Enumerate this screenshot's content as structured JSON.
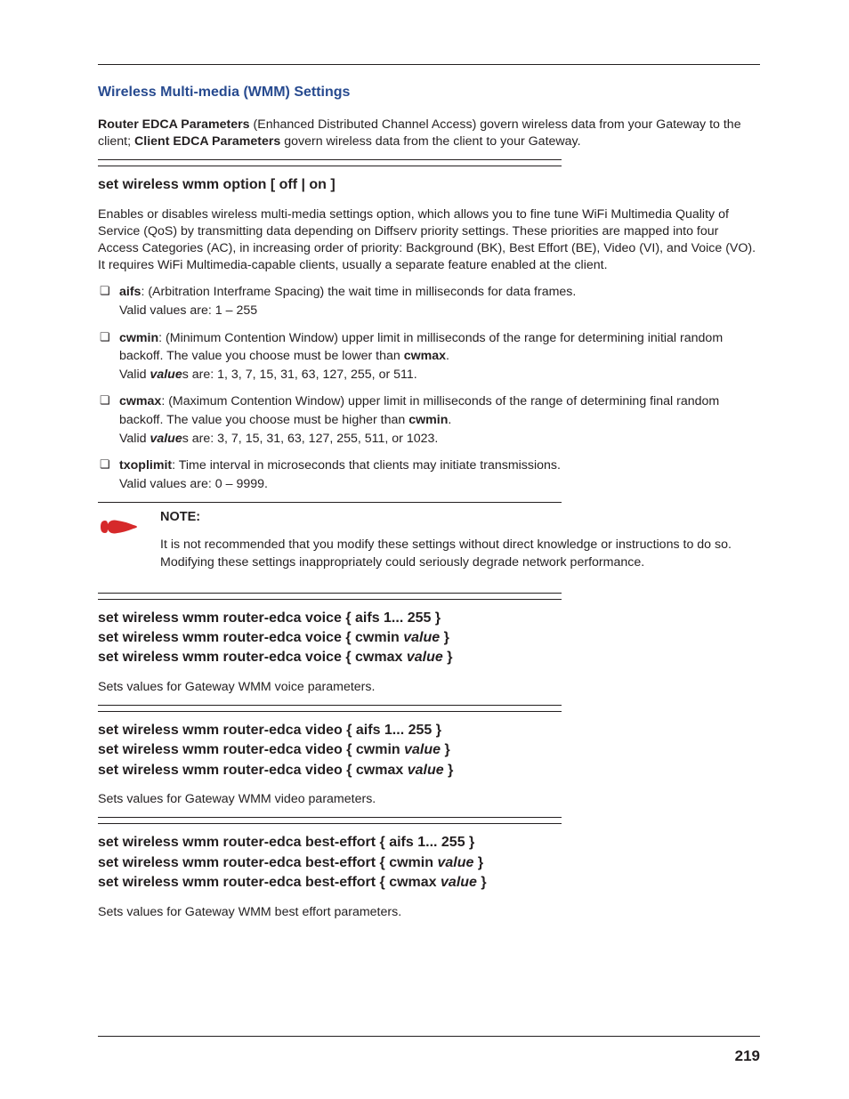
{
  "section_title": "Wireless Multi-media (WMM) Settings",
  "intro": {
    "b1": "Router EDCA Parameters",
    "t1": " (Enhanced Distributed Channel Access) govern wireless data from your Gateway to the client; ",
    "b2": "Client EDCA Parameters",
    "t2": " govern wireless data from the client to your Gateway."
  },
  "cmd1": {
    "title": "set wireless wmm option [ off | on ]",
    "desc": "Enables or disables wireless multi-media settings option, which allows you to fine tune WiFi Multimedia Quality of Service (QoS) by transmitting data depending on Diffserv priority settings. These priorities are mapped into four Access Categories (AC), in increasing order of priority: Background (BK), Best Effort (BE), Video (VI), and Voice (VO). It requires WiFi Multimedia-capable clients, usually a separate feature enabled at the client."
  },
  "bullets": {
    "aifs": {
      "label": "aifs",
      "desc": ": (Arbitration Interframe Spacing) the wait time in milliseconds for data frames.",
      "valid": "Valid values are: 1 – 255"
    },
    "cwmin": {
      "label": "cwmin",
      "desc1": ": (Minimum Contention Window) upper limit in milliseconds of the range for determining initial random backoff. The value you choose must be lower than ",
      "ref": "cwmax",
      "valid_pre": "Valid ",
      "valid_em": "value",
      "valid_post": "s are: 1, 3, 7, 15, 31, 63, 127, 255, or 511."
    },
    "cwmax": {
      "label": "cwmax",
      "desc1": ": (Maximum Contention Window) upper limit in milliseconds of the range of determining final random backoff. The value you choose must be higher than ",
      "ref": "cwmin",
      "valid_pre": "Valid ",
      "valid_em": "value",
      "valid_post": "s are: 3, 7, 15, 31, 63, 127, 255, 511, or 1023."
    },
    "txop": {
      "label": "txoplimit",
      "desc": ": Time interval in microseconds that clients may initiate transmissions.",
      "valid": "Valid values are: 0 – 9999."
    }
  },
  "note": {
    "heading": "NOTE:",
    "body": "It is not recommended that you modify these settings without direct knowledge or instructions to do so. Modifying these settings inappropriately could seriously degrade network performance."
  },
  "groups": [
    {
      "lines": [
        {
          "pre": "set wireless wmm router-edca voice { aifs 1... 255 }"
        },
        {
          "pre": "set wireless wmm router-edca voice { cwmin ",
          "em": "value",
          "post": " }"
        },
        {
          "pre": "set wireless wmm router-edca voice { cwmax ",
          "em": "value",
          "post": " }"
        }
      ],
      "desc": "Sets values for Gateway WMM voice parameters."
    },
    {
      "lines": [
        {
          "pre": "set wireless wmm router-edca video { aifs 1... 255 }"
        },
        {
          "pre": "set wireless wmm router-edca video { cwmin ",
          "em": "value",
          "post": " }"
        },
        {
          "pre": "set wireless wmm router-edca video { cwmax ",
          "em": "value",
          "post": " }"
        }
      ],
      "desc": "Sets values for Gateway WMM video parameters."
    },
    {
      "lines": [
        {
          "pre": "set wireless wmm router-edca best-effort { aifs 1... 255 }"
        },
        {
          "pre": "set wireless wmm router-edca best-effort { cwmin ",
          "em": "value",
          "post": " }"
        },
        {
          "pre": "set wireless wmm router-edca best-effort { cwmax ",
          "em": "value",
          "post": " }"
        }
      ],
      "desc": "Sets values for Gateway WMM best effort parameters."
    }
  ],
  "page_number": "219"
}
